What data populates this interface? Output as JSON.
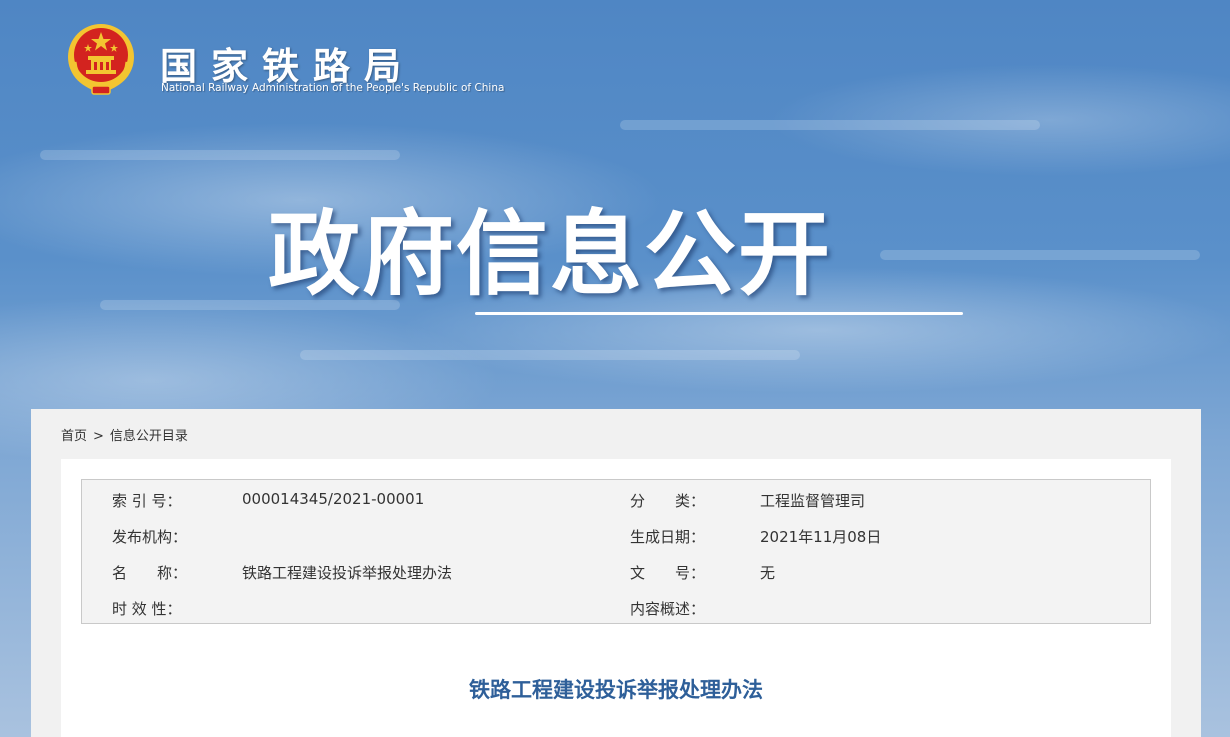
{
  "header": {
    "org_name_cn": "国家铁路局",
    "org_name_en": "National Railway Administration of the People's Republic of China",
    "hero_title": "政府信息公开"
  },
  "breadcrumb": {
    "home": "首页",
    "separator": ">",
    "current": "信息公开目录"
  },
  "meta": {
    "index_no": {
      "label": "索 引 号：",
      "value": "000014345/2021-00001"
    },
    "category": {
      "label": "分　　类：",
      "value": "工程监督管理司"
    },
    "publisher": {
      "label": "发布机构：",
      "value": ""
    },
    "created_date": {
      "label": "生成日期：",
      "value": "2021年11月08日"
    },
    "name": {
      "label": "名　　称：",
      "value": "铁路工程建设投诉举报处理办法"
    },
    "doc_no": {
      "label": "文　　号：",
      "value": "无"
    },
    "validity": {
      "label": "时 效 性：",
      "value": ""
    },
    "summary": {
      "label": "内容概述：",
      "value": ""
    }
  },
  "document": {
    "title": "铁路工程建设投诉举报处理办法"
  },
  "colors": {
    "title_blue": "#2e5f99",
    "emblem_red": "#d3231f",
    "emblem_gold": "#f3c531"
  },
  "icons": {
    "emblem": "national-emblem-icon"
  }
}
